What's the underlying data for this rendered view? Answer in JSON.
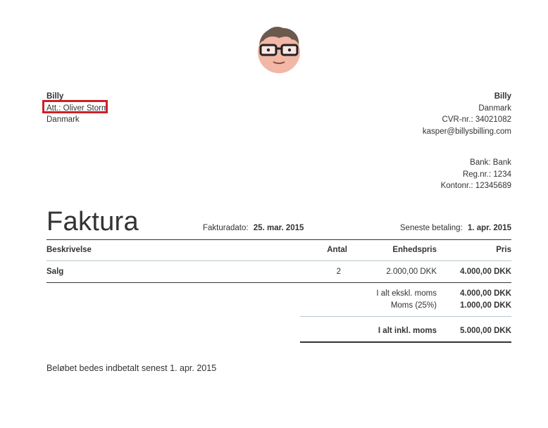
{
  "recipient": {
    "name": "Billy",
    "attention": "Att.: Oliver Storm",
    "country": "Danmark"
  },
  "sender": {
    "name": "Billy",
    "country": "Danmark",
    "cvr": "CVR-nr.: 34021082",
    "email": "kasper@billysbilling.com"
  },
  "bank": {
    "bank": "Bank: Bank",
    "reg": "Reg.nr.: 1234",
    "account": "Kontonr.: 12345689"
  },
  "invoice": {
    "title": "Faktura",
    "date_label": "Fakturadato:",
    "date_value": "25. mar. 2015",
    "due_label": "Seneste betaling:",
    "due_value": "1. apr. 2015"
  },
  "table": {
    "headers": {
      "description": "Beskrivelse",
      "quantity": "Antal",
      "unit_price": "Enhedspris",
      "price": "Pris"
    },
    "rows": [
      {
        "description": "Salg",
        "quantity": "2",
        "unit_price": "2.000,00 DKK",
        "price": "4.000,00 DKK"
      }
    ]
  },
  "totals": {
    "subtotal_label": "I alt ekskl. moms",
    "subtotal_value": "4.000,00 DKK",
    "vat_label": "Moms (25%)",
    "vat_value": "1.000,00 DKK",
    "total_label": "I alt inkl. moms",
    "total_value": "5.000,00 DKK"
  },
  "footer": {
    "note": "Beløbet bedes indbetalt senest 1. apr. 2015"
  },
  "colors": {
    "highlight": "#d01f2a",
    "text": "#333333",
    "divider": "#b9c6cc"
  },
  "logo_icon": "cartoon-face-with-glasses-icon"
}
